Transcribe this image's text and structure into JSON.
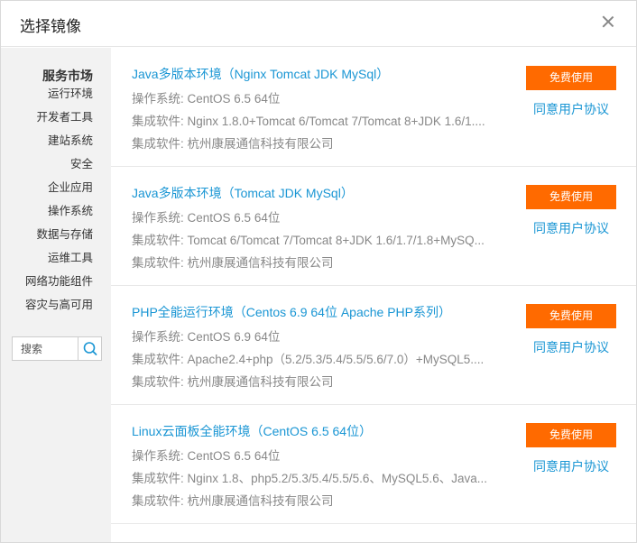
{
  "dialog": {
    "title": "选择镜像"
  },
  "sidebar": {
    "heading": "服务市场",
    "items": [
      {
        "label": "运行环境"
      },
      {
        "label": "开发者工具"
      },
      {
        "label": "建站系统"
      },
      {
        "label": "安全"
      },
      {
        "label": "企业应用"
      },
      {
        "label": "操作系统"
      },
      {
        "label": "数据与存储"
      },
      {
        "label": "运维工具"
      },
      {
        "label": "网络功能组件"
      },
      {
        "label": "容灾与高可用"
      }
    ],
    "search": {
      "placeholder": "搜索"
    }
  },
  "labels": {
    "os": "操作系统:",
    "software": "集成软件:",
    "free_button": "免费使用",
    "agree_link": "同意用户协议"
  },
  "images": [
    {
      "title": "Java多版本环境（Nginx Tomcat JDK MySql）",
      "os": "CentOS 6.5 64位",
      "software": "Nginx 1.8.0+Tomcat 6/Tomcat 7/Tomcat 8+JDK 1.6/1....",
      "vendor": "杭州康展通信科技有限公司"
    },
    {
      "title": "Java多版本环境（Tomcat JDK MySql）",
      "os": "CentOS 6.5 64位",
      "software": "Tomcat 6/Tomcat 7/Tomcat 8+JDK 1.6/1.7/1.8+MySQ...",
      "vendor": "杭州康展通信科技有限公司"
    },
    {
      "title": "PHP全能运行环境（Centos 6.9 64位 Apache PHP系列）",
      "os": "CentOS 6.9 64位",
      "software": "Apache2.4+php（5.2/5.3/5.4/5.5/5.6/7.0）+MySQL5....",
      "vendor": "杭州康展通信科技有限公司"
    },
    {
      "title": "Linux云面板全能环境（CentOS 6.5 64位）",
      "os": "CentOS 6.5 64位",
      "software": "Nginx 1.8、php5.2/5.3/5.4/5.5/5.6、MySQL5.6、Java...",
      "vendor": "杭州康展通信科技有限公司"
    }
  ],
  "colors": {
    "accent_orange": "#ff6a00",
    "link_blue": "#1a96d4"
  }
}
